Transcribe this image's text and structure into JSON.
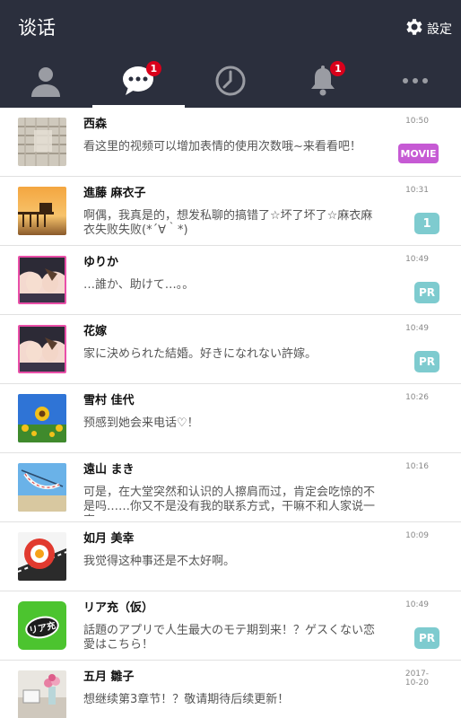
{
  "header": {
    "title": "谈话",
    "settings_label": "設定"
  },
  "tabs": [
    {
      "icon": "person-icon",
      "badge": ""
    },
    {
      "icon": "chat-bubble-icon",
      "badge": "1",
      "active": true
    },
    {
      "icon": "clock-icon",
      "badge": ""
    },
    {
      "icon": "bell-icon",
      "badge": "1"
    },
    {
      "icon": "more-icon",
      "badge": ""
    }
  ],
  "chats": [
    {
      "name": "西森",
      "time": "10:50",
      "message": "看这里的视频可以增加表情的使用次数哦~来看看吧！",
      "badge": "MOVIE",
      "avatar": "fabric-avatar"
    },
    {
      "name": "進藤 麻衣子",
      "time": "10:31",
      "message": "啊偶，我真是的，想发私聊的搞错了☆坏了坏了☆麻衣麻衣失败失败(*´∀｀*)",
      "badge": "1",
      "avatar": "pier-sunset-avatar"
    },
    {
      "name": "ゆりか",
      "time": "10:49",
      "message": "…誰か、助けて…。。",
      "badge": "PR",
      "avatar": "anime-couple-avatar"
    },
    {
      "name": "花嫁",
      "time": "10:49",
      "message": "家に決められた結婚。好きになれない許嫁。",
      "badge": "PR",
      "avatar": "anime-couple-avatar"
    },
    {
      "name": "雪村 佳代",
      "time": "10:26",
      "message": "预感到她会来电话♡！",
      "badge": "",
      "avatar": "sunflower-avatar"
    },
    {
      "name": "遠山 まき",
      "time": "10:16",
      "message": "可是，在大堂突然和认识的人擦肩而过，肯定会吃惊的不是吗……你又不是没有我的联系方式，干嘛不和人家说一声",
      "badge": "",
      "avatar": "hammock-avatar"
    },
    {
      "name": "如月 美幸",
      "time": "10:09",
      "message": "我觉得这种事还是不太好啊。",
      "badge": "",
      "avatar": "egg-plate-avatar"
    },
    {
      "name": "リア充（仮）",
      "time": "10:49",
      "message": "話題のアプリで人生最大のモテ期到来！？ゲスくない恋愛はこちら！",
      "badge": "PR",
      "avatar": "riajuu-logo-avatar",
      "avatar_text": "リア充"
    },
    {
      "name": "五月 雛子",
      "time_line1": "2017-",
      "time_line2": "10-20",
      "message": "想继续第3章节！？敬请期待后续更新！",
      "badge": "",
      "avatar": "flowers-desk-avatar"
    }
  ],
  "colors": {
    "header_bg": "#2b2f3d",
    "badge_red": "#d9001b",
    "pill_teal": "#7ecbcf",
    "pill_purple": "#c65ad4"
  }
}
